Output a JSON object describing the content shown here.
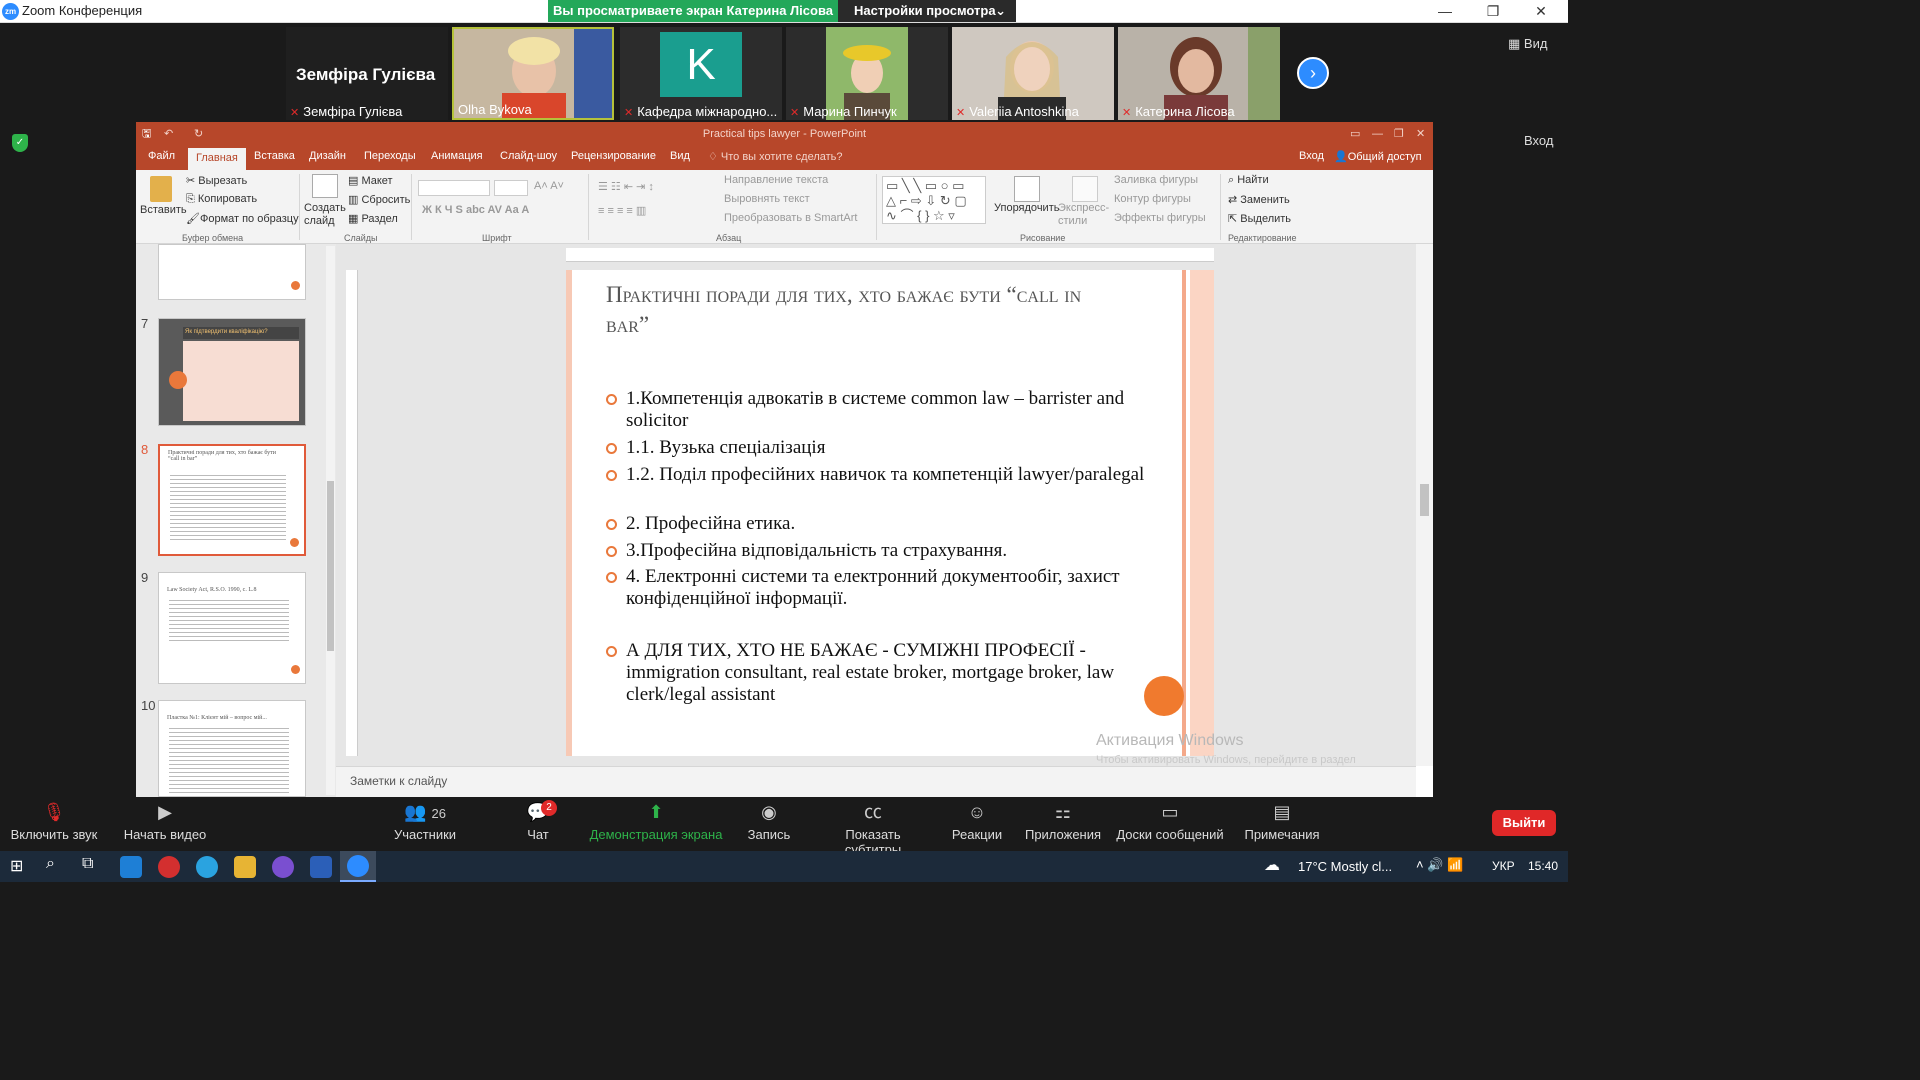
{
  "window": {
    "title": "Zoom Конференция",
    "app_icon": "zoom-logo-icon"
  },
  "share": {
    "banner": "Вы просматриваете экран Катерина Лісова",
    "view_settings": "Настройки просмотра"
  },
  "meeting": {
    "view_label": "Вид",
    "enter_label": "Вход"
  },
  "participants": [
    {
      "name": "Земфіра Гулієва",
      "tile_label": "Земфіра Гулієва",
      "video": false
    },
    {
      "name": "Olha Bykova",
      "video": true,
      "active_speaker": true
    },
    {
      "name": "Кафедра міжнародно...",
      "avatar_letter": "K",
      "avatar_color": "#1a9e8f"
    },
    {
      "name": "Марина Пинчук",
      "video": true
    },
    {
      "name": "Valeriia Antoshkina",
      "video": true
    },
    {
      "name": "Катерина Лісова",
      "video": true
    }
  ],
  "ppt": {
    "title": "Practical tips lawyer - PowerPoint",
    "tabs": [
      "Файл",
      "Главная",
      "Вставка",
      "Дизайн",
      "Переходы",
      "Анимация",
      "Слайд-шоу",
      "Рецензирование",
      "Вид"
    ],
    "active_tab": "Главная",
    "tell_me": "Что вы хотите сделать?",
    "sign_in": "Вход",
    "share": "Общий доступ",
    "ribbon": {
      "paste": "Вставить",
      "cut": "Вырезать",
      "copy": "Копировать",
      "format_painter": "Формат по образцу",
      "clipboard_group": "Буфер обмена",
      "create_slide": "Создать слайд",
      "layout": "Макет",
      "reset": "Сбросить",
      "section": "Раздел",
      "slides_group": "Слайды",
      "font_group": "Шрифт",
      "text_direction": "Направление текста",
      "align_text": "Выровнять текст",
      "smartart": "Преобразовать в SmartArt",
      "paragraph_group": "Абзац",
      "arrange": "Упорядочить",
      "quick_styles": "Экспресс-стили",
      "shape_fill": "Заливка фигуры",
      "shape_outline": "Контур фигуры",
      "shape_effects": "Эффекты фигуры",
      "drawing_group": "Рисование",
      "find": "Найти",
      "replace": "Заменить",
      "select": "Выделить",
      "editing_group": "Редактирование"
    },
    "thumbnails": [
      {
        "number": "7",
        "title": "Як підтвердити кваліфікацію?"
      },
      {
        "number": "8",
        "title": "Практичні поради для тих, хто бажає бути “call in bar”",
        "selected": true
      },
      {
        "number": "9",
        "title": "Law Society Act, R.S.O. 1990, c. L.8"
      },
      {
        "number": "10",
        "title": "Пластка №1: Клієнт мій – вопрос мій..."
      }
    ],
    "slide": {
      "title": "Практичні поради для тих, хто бажає бути “call in bar”",
      "bullets": [
        "1.Компетенція адвокатів в системе common law – barrister and solicitor",
        "1.1. Вузька спеціалізація",
        "1.2. Поділ професійних навичок та компетенцій lawyer/paralegal",
        "2. Професійна етика.",
        "3.Професійна відповідальність та страхування.",
        "4. Електронні системи та електронний документообіг, захист конфіденційної інформації."
      ],
      "extra_bullet": "А ДЛЯ ТИХ, ХТО НЕ БАЖАЄ -  СУМІЖНІ ПРОФЕСІЇ -  immigration consultant, real estate broker, mortgage broker, law clerk/legal assistant",
      "accent_color": "#e9783b"
    },
    "notes_placeholder": "Заметки к слайду",
    "watermark_title": "Активация Windows",
    "watermark_sub": "Чтобы активировать Windows, перейдите в раздел \"Параметры\"."
  },
  "toolbar": {
    "unmute": "Включить звук",
    "start_video": "Начать видео",
    "participants": "Участники",
    "participants_count": "26",
    "chat": "Чат",
    "chat_badge": "2",
    "share_screen": "Демонстрация экрана",
    "record": "Запись",
    "captions": "Показать субтитры",
    "reactions": "Реакции",
    "apps": "Приложения",
    "whiteboards": "Доски сообщений",
    "notes": "Примечания",
    "leave": "Выйти"
  },
  "taskbar": {
    "weather": "17°C  Mostly cl...",
    "lang": "УКР",
    "time": "15:40"
  }
}
